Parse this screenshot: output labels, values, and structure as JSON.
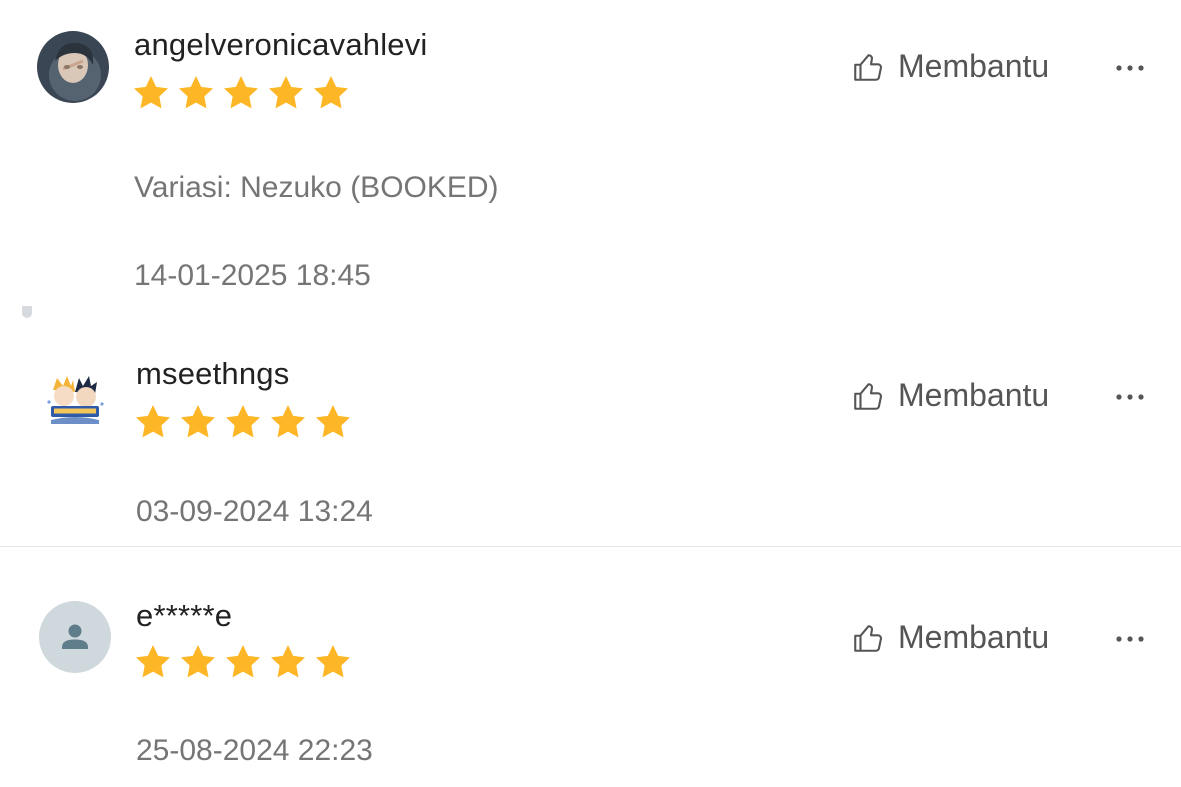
{
  "reviews": [
    {
      "username": "angelveronicavahlevi",
      "rating": 5,
      "rating_max": 5,
      "variation": "Variasi: Nezuko (BOOKED)",
      "timestamp": "14-01-2025 18:45",
      "helpful_label": "Membantu",
      "avatar": "photo-avatar"
    },
    {
      "username": "mseethngs",
      "rating": 5,
      "rating_max": 5,
      "timestamp": "03-09-2024 13:24",
      "helpful_label": "Membantu",
      "avatar": "anime-avatar"
    },
    {
      "username": "e*****e",
      "rating": 5,
      "rating_max": 5,
      "timestamp": "25-08-2024 22:23",
      "helpful_label": "Membantu",
      "avatar": "default-user-icon"
    }
  ],
  "colors": {
    "star": "#FDB726",
    "text_primary": "#222222",
    "text_secondary": "#757575",
    "divider": "#E6E6E6"
  },
  "icons": {
    "helpful": "thumbs-up-icon",
    "more": "more-dots-icon",
    "star": "star-icon"
  }
}
